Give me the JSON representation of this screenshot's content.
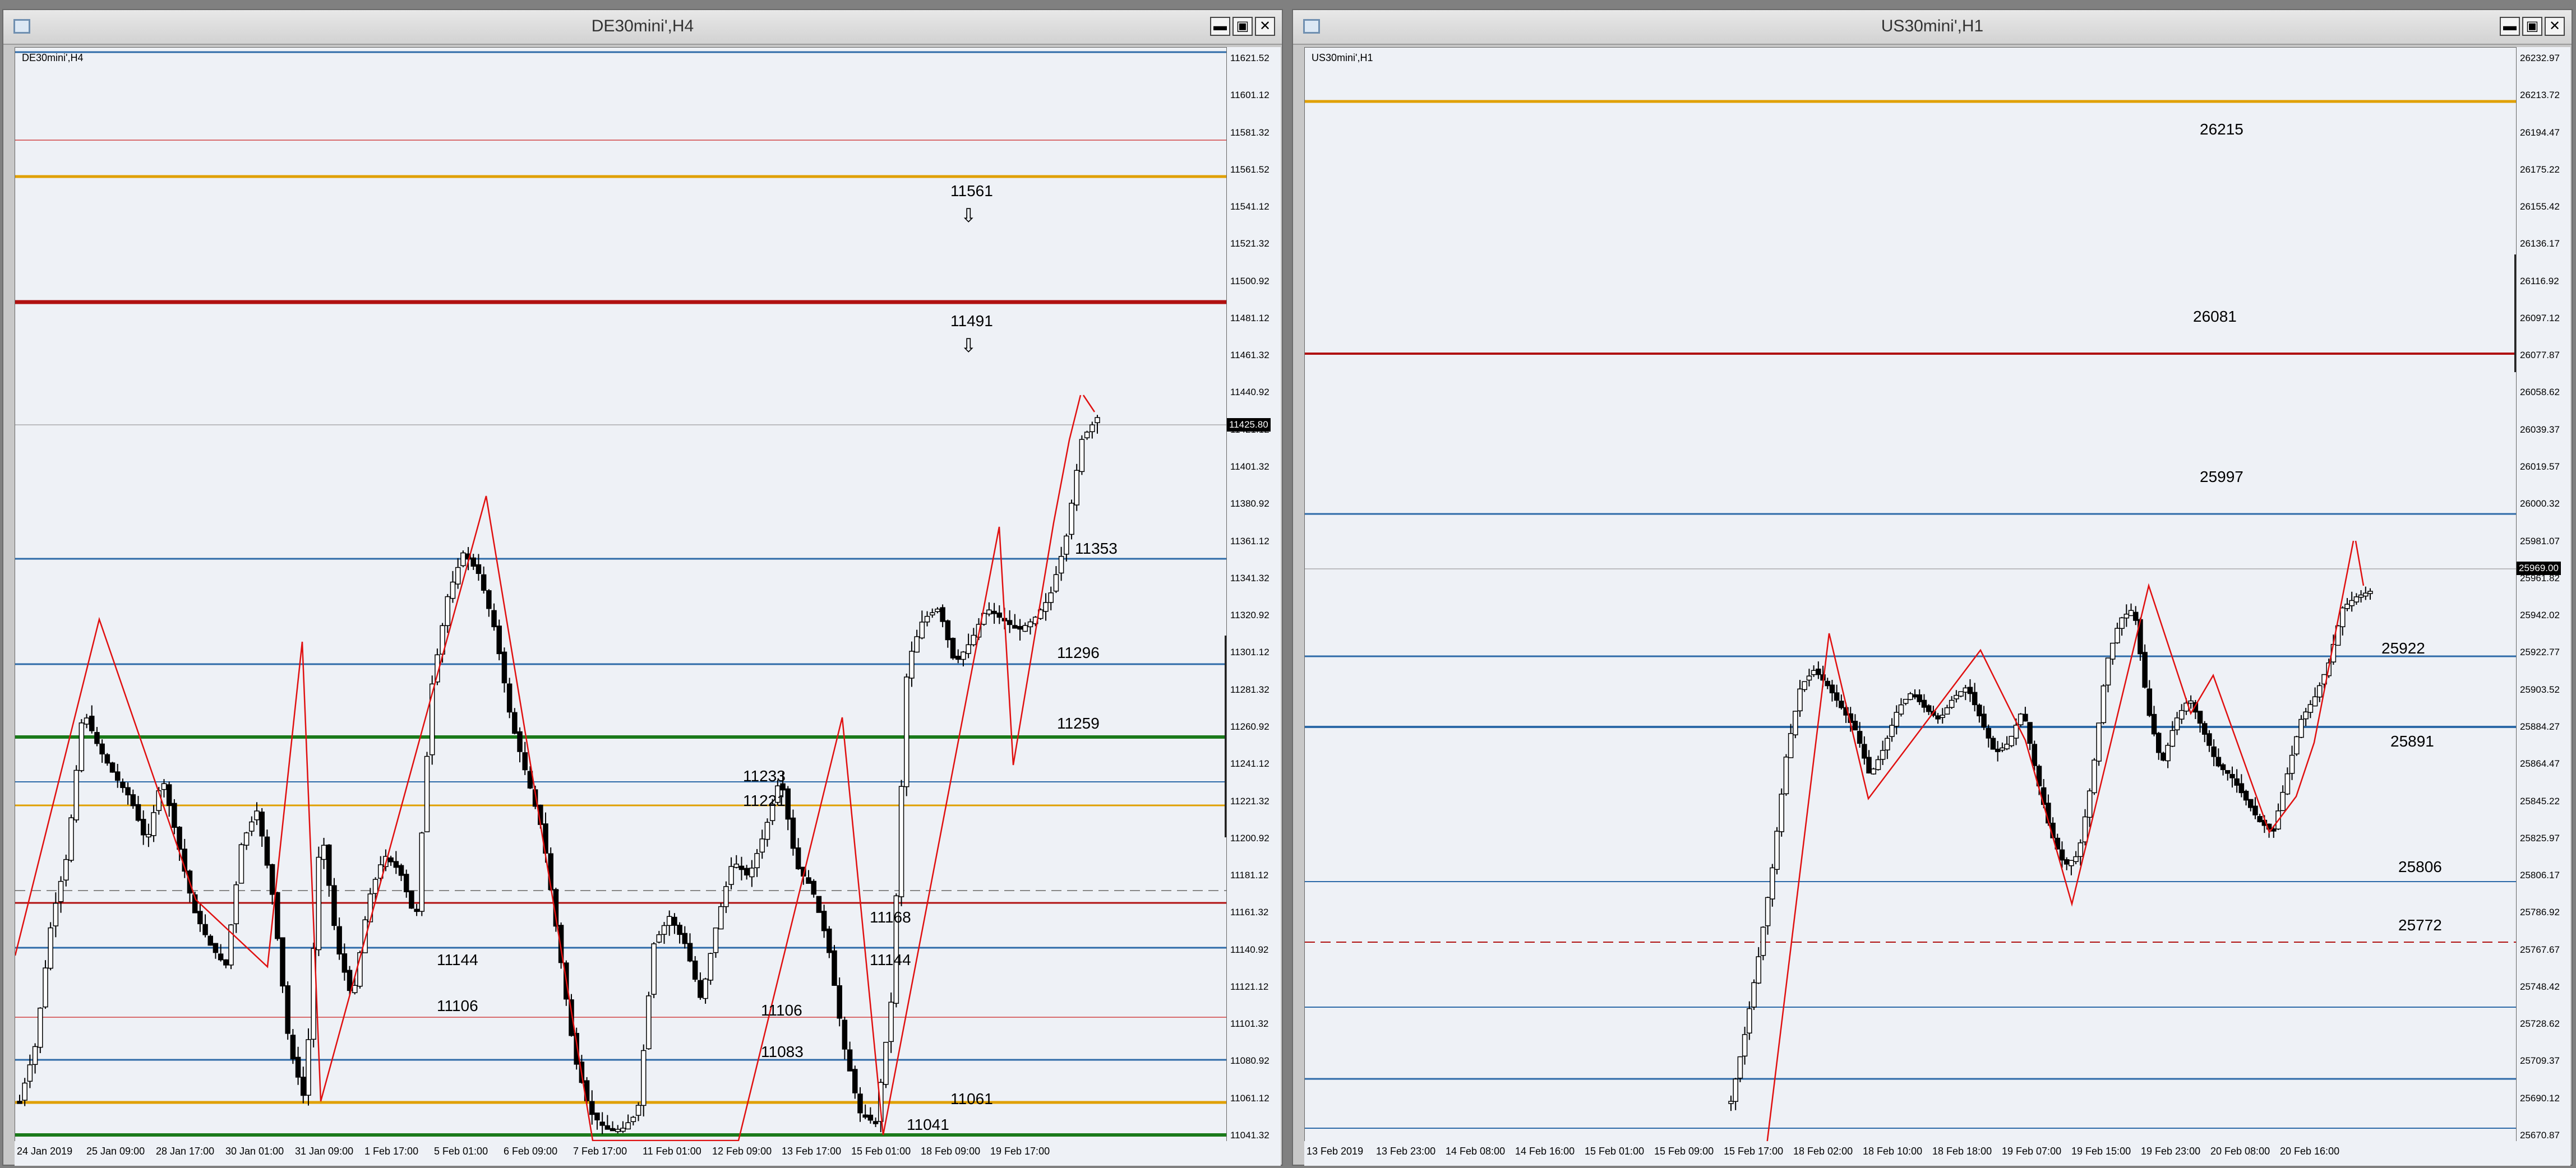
{
  "colors": {
    "background": "#eef1f6",
    "bull_candle": "#ffffff",
    "bear_candle": "#000000",
    "zigzag": "#e01010",
    "level_blue": "#2d6aa8",
    "level_gold": "#e0a000",
    "level_darkred": "#b01010",
    "level_red_thin": "#d04040",
    "level_green": "#1a7a1a",
    "level_gray": "#888888"
  },
  "windows": [
    {
      "id": "left",
      "title": "DE30mini',H4",
      "symbol_label": "DE30mini',H4",
      "current_price": "11425.80",
      "y_ticks": [
        "11621.52",
        "11601.12",
        "11581.32",
        "11561.52",
        "11541.12",
        "11521.32",
        "11500.92",
        "11481.12",
        "11461.32",
        "11440.92",
        "11421.12",
        "11401.32",
        "11380.92",
        "11361.12",
        "11341.32",
        "11320.92",
        "11301.12",
        "11281.32",
        "11260.92",
        "11241.12",
        "11221.32",
        "11200.92",
        "11181.12",
        "11161.32",
        "11140.92",
        "11121.12",
        "11101.32",
        "11080.92",
        "11061.12",
        "11041.32"
      ],
      "x_ticks": [
        "24 Jan 2019",
        "25 Jan 09:00",
        "28 Jan 17:00",
        "30 Jan 01:00",
        "31 Jan 09:00",
        "1 Feb 17:00",
        "5 Feb 01:00",
        "6 Feb 09:00",
        "7 Feb 17:00",
        "11 Feb 01:00",
        "12 Feb 09:00",
        "13 Feb 17:00",
        "15 Feb 01:00",
        "18 Feb 09:00",
        "19 Feb 17:00"
      ],
      "level_labels": [
        {
          "text": "11561",
          "arrow": "⇩"
        },
        {
          "text": "11491",
          "arrow": "⇩"
        },
        {
          "text": "11353"
        },
        {
          "text": "11296"
        },
        {
          "text": "11259"
        },
        {
          "text": "11233"
        },
        {
          "text": "11221"
        },
        {
          "text": "11168"
        },
        {
          "text": "11144"
        },
        {
          "text": "11144"
        },
        {
          "text": "11106"
        },
        {
          "text": "11106"
        },
        {
          "text": "11083"
        },
        {
          "text": "11061"
        },
        {
          "text": "11041"
        }
      ]
    },
    {
      "id": "right",
      "title": "US30mini',H1",
      "symbol_label": "US30mini',H1",
      "current_price": "25969.00",
      "y_ticks": [
        "26232.97",
        "26213.72",
        "26194.47",
        "26175.22",
        "26155.42",
        "26136.17",
        "26116.92",
        "26097.12",
        "26077.87",
        "26058.62",
        "26039.37",
        "26019.57",
        "26000.32",
        "25981.07",
        "25961.82",
        "25942.02",
        "25922.77",
        "25903.52",
        "25884.27",
        "25864.47",
        "25845.22",
        "25825.97",
        "25806.17",
        "25786.92",
        "25767.67",
        "25748.42",
        "25728.62",
        "25709.37",
        "25690.12",
        "25670.87"
      ],
      "x_ticks": [
        "13 Feb 2019",
        "13 Feb 23:00",
        "14 Feb 08:00",
        "14 Feb 16:00",
        "15 Feb 01:00",
        "15 Feb 09:00",
        "15 Feb 17:00",
        "18 Feb 02:00",
        "18 Feb 10:00",
        "18 Feb 18:00",
        "19 Feb 07:00",
        "19 Feb 15:00",
        "19 Feb 23:00",
        "20 Feb 08:00",
        "20 Feb 16:00"
      ],
      "level_labels": [
        {
          "text": "26215"
        },
        {
          "text": "26081"
        },
        {
          "text": "25997"
        },
        {
          "text": "25922"
        },
        {
          "text": "25891"
        },
        {
          "text": "25806"
        },
        {
          "text": "25772"
        }
      ]
    }
  ]
}
